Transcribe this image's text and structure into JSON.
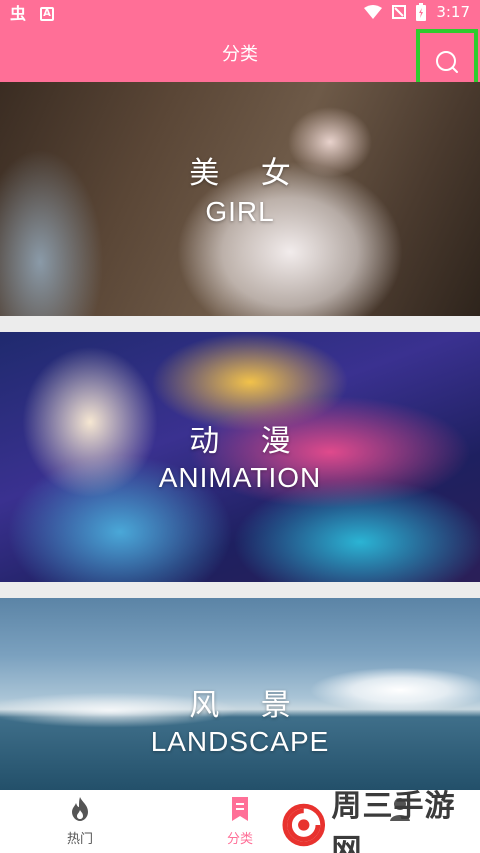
{
  "status_bar": {
    "left_glyph": "虫",
    "left_badge": "A",
    "time": "3:17"
  },
  "app_bar": {
    "title": "分类",
    "search_icon": "search-icon"
  },
  "categories": [
    {
      "cn": "美 女",
      "en": "GIRL"
    },
    {
      "cn": "动 漫",
      "en": "ANIMATION"
    },
    {
      "cn": "风 景",
      "en": "LANDSCAPE"
    }
  ],
  "bottom_nav": {
    "tabs": [
      {
        "label": "热门",
        "icon": "flame-icon",
        "active": false
      },
      {
        "label": "分类",
        "icon": "bookmark-icon",
        "active": true
      },
      {
        "label": "",
        "icon": "user-icon",
        "active": false
      }
    ]
  },
  "watermark": {
    "text": "周三手游网"
  },
  "colors": {
    "accent": "#ff6f97",
    "highlight_box": "#2ecc2e"
  }
}
